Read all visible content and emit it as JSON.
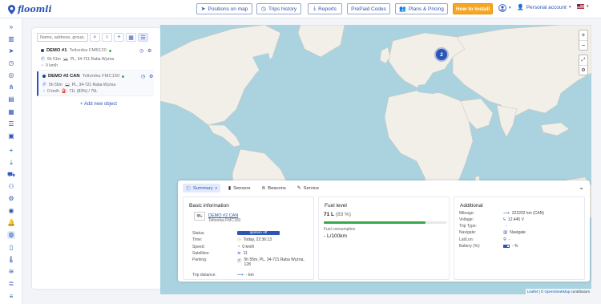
{
  "app": {
    "logo_text": "floomli"
  },
  "topbar": {
    "positions_on_map": "Positions on map",
    "trips_history": "Trips history",
    "reports": "Reports",
    "prepaid_codes": "PrePaid Codes",
    "plans_pricing": "Plans & Pricing",
    "how_to_install": "How to install",
    "personal_account": "Personal account",
    "language_caret": "▾"
  },
  "sidebar": {
    "search_placeholder": "Name, address, group...",
    "add_new_object": "Add new object",
    "objects": [
      {
        "name": "DEMO #1",
        "model": "Teltonika FMB120",
        "duration": "5h 51m",
        "address": "PL, 34-721 Raba Wyżna",
        "speed": "0 km/h",
        "fuel": ""
      },
      {
        "name": "DEMO #2 CAN",
        "model": "Teltonika FMC150",
        "duration": "5h 55m",
        "address": "PL, 34-721 Raba Wyżna",
        "speed": "0 km/h",
        "fuel": "71L (83%) / 75L"
      }
    ]
  },
  "map": {
    "cluster_count": "2",
    "zoom_in": "+",
    "zoom_out": "−",
    "attribution_leaflet": "Leaflet",
    "attribution_sep": " | © ",
    "attribution_osm": "OpenStreetMap",
    "attribution_tail": " contributors"
  },
  "detail": {
    "tabs": {
      "summary": "Summary",
      "sensors": "Sensors",
      "beacons": "Beacons",
      "service": "Service"
    },
    "basic": {
      "title": "Basic information",
      "object_name": "DEMO #2 CAN",
      "object_model": "Teltonika FMC150",
      "status_label": "Status:",
      "status_value": "Ignition off",
      "time_label": "Time:",
      "time_value": "Today, 22:36:13",
      "speed_label": "Speed:",
      "speed_value": "0 km/h",
      "satellites_label": "Satellites:",
      "satellites_value": "11",
      "parking_label": "Parking:",
      "parking_value_1": "5h 55m, PL, 34-721 Raba Wyżna,",
      "parking_value_2": "128",
      "trip_label": "Trip distance:",
      "trip_value": "- km"
    },
    "fuel": {
      "title": "Fuel level",
      "level_value": "71 L",
      "level_percent": "(83 %)",
      "level_fraction": 0.83,
      "consumption_label": "Fuel consumption",
      "consumption_value": "- L/100km"
    },
    "additional": {
      "title": "Additional",
      "mileage_label": "Mileage:",
      "mileage_value": "222202 km (CAN)",
      "voltage_label": "Voltage:",
      "voltage_value": "12.445 V",
      "trip_type_label": "Trip Type:",
      "trip_type_value": "-",
      "navigate_label": "Navigate:",
      "navigate_value": "Navigate",
      "latlon_label": "Lat/Lon:",
      "latlon_value": "-",
      "battery_label": "Battery (%):",
      "battery_value": "- %"
    }
  },
  "colors": {
    "brand": "#2c55b6",
    "accent_orange": "#f5a623",
    "water": "#aad3df",
    "land": "#f2efe9",
    "fuel_bar": "#3aa84a"
  }
}
